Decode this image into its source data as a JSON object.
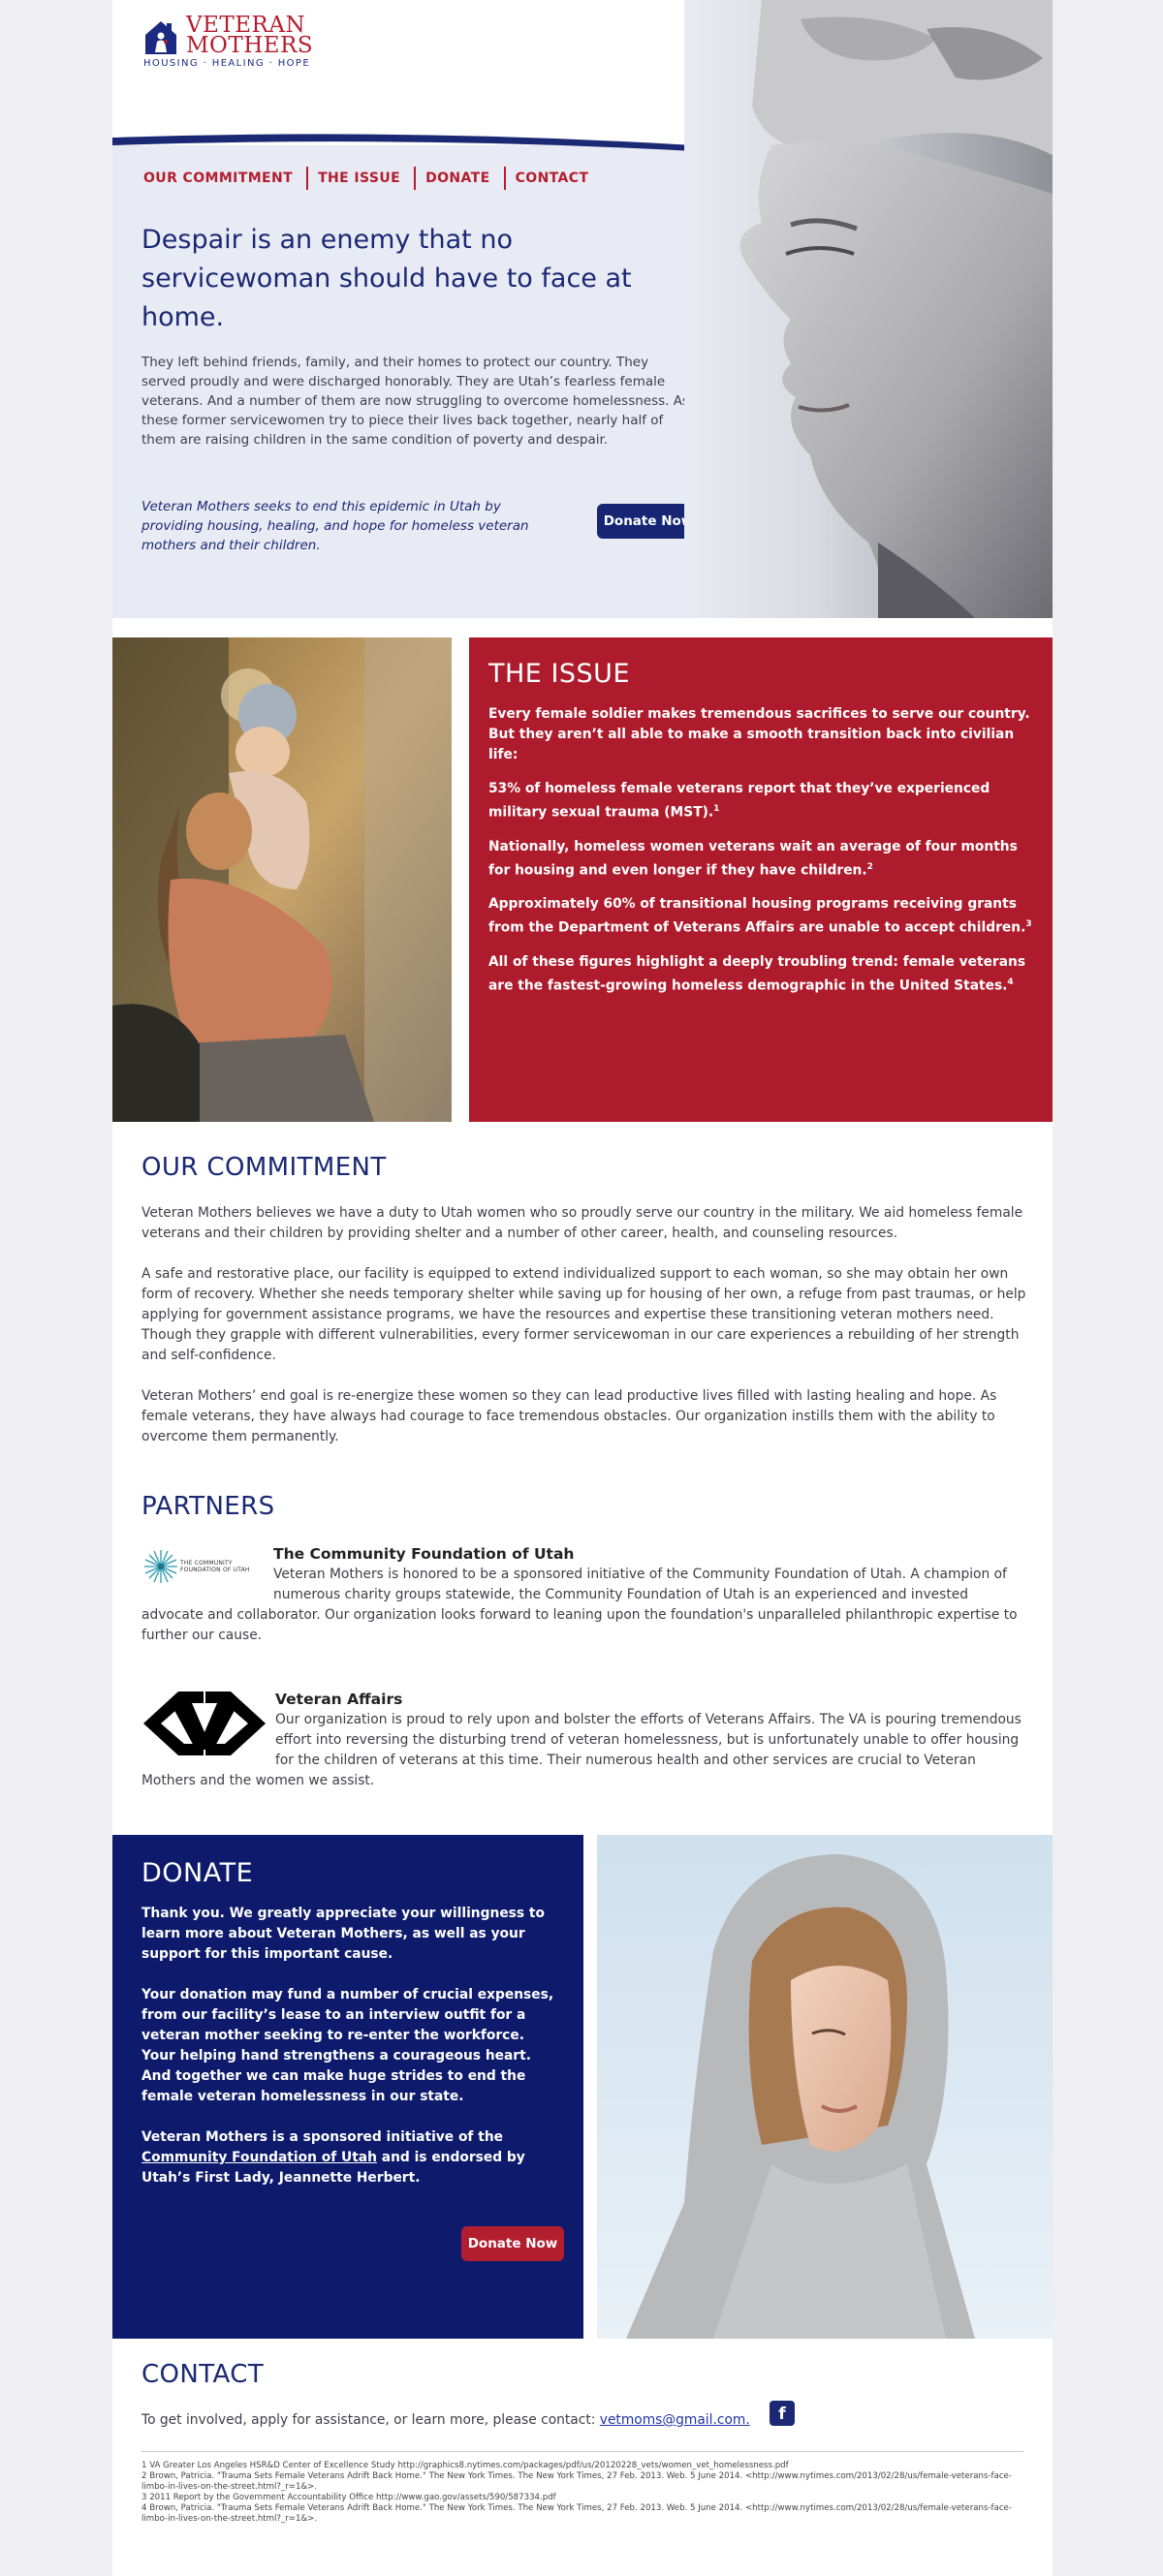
{
  "brand": {
    "name_line1": "VETERAN",
    "name_line2": "MOTHERS",
    "tagline": "HOUSING · HEALING · HOPE",
    "navy": "#162674",
    "red": "#ae1b2c"
  },
  "nav": {
    "items": [
      "OUR COMMITMENT",
      "THE ISSUE",
      "DONATE",
      "CONTACT"
    ]
  },
  "hero": {
    "heading": "Despair is an enemy that no servicewoman should have to face at home.",
    "body": "They left behind friends, family, and their homes to protect our country. They served proudly and were discharged honorably. They are Utah’s fearless female veterans. And a number of them are now struggling to overcome homelessness. As these former servicewomen try to piece their lives back together, nearly half of them are raising children in the same condition of poverty and despair.",
    "mission": "Veteran Mothers seeks to end this epidemic in Utah by providing housing, healing, and hope for homeless veteran mothers and their children.",
    "donate_label": "Donate Now"
  },
  "issue": {
    "title": "THE ISSUE",
    "intro": "Every female soldier makes tremendous sacrifices to serve our country. But they aren’t all able to make a smooth transition back into civilian life:",
    "stat1": "53% of homeless female veterans report that they’ve experienced military sexual trauma (MST).",
    "stat1_ref": "1",
    "stat2": "Nationally, homeless women veterans wait an average of four months for housing and even longer if they have children.",
    "stat2_ref": "2",
    "stat3": "Approximately 60% of transitional housing programs receiving grants from the Department of Veterans Affairs are unable to accept children.",
    "stat3_ref": "3",
    "stat4": "All of these figures highlight a deeply troubling trend: female veterans are the fastest-growing homeless demographic in the United States.",
    "stat4_ref": "4"
  },
  "commitment": {
    "title": "OUR COMMITMENT",
    "p1": "Veteran Mothers believes we have a duty to Utah women who so proudly serve our country in the military. We aid homeless female veterans and their children by providing shelter and a number of other career, health, and counseling resources.",
    "p2": "A safe and restorative place, our facility is equipped to extend individualized support to each woman, so she may obtain her own form of recovery. Whether she needs temporary shelter while saving up for housing of her own, a refuge from past traumas, or help applying for government assistance programs, we have the resources and expertise these transitioning veteran mothers need. Though they grapple with different vulnerabilities, every former servicewoman in our care experiences a rebuilding of her strength and self-confidence.",
    "p3": "Veteran Mothers’ end goal is re-energize these women so they can lead productive lives filled with lasting healing and hope. As female veterans, they have always had courage to face tremendous obstacles. Our organization instills them with the ability to overcome them permanently."
  },
  "partners": {
    "title": "PARTNERS",
    "cfu_logo_text": "THE COMMUNITY FOUNDATION OF UTAH",
    "cfu_name": "The Community Foundation of Utah",
    "cfu_text": "Veteran Mothers is honored to be a sponsored initiative of the Community Foundation of Utah. A champion of numerous charity groups statewide, the Community Foundation of Utah is an experienced and invested advocate and collaborator. Our organization looks forward to leaning upon the foundation's unparalleled philanthropic expertise to further our cause.",
    "va_name": "Veteran Affairs",
    "va_text": "Our organization is proud to rely upon and bolster the efforts of Veterans Affairs. The VA is pouring tremendous effort into reversing the disturbing trend of veteran homelessness, but is unfortunately unable to offer housing for the children of veterans at this time. Their numerous health and other services are crucial to Veteran Mothers and the women we assist."
  },
  "donate": {
    "title": "DONATE",
    "p1": "Thank you. We greatly appreciate your willingness to learn more about Veteran Mothers, as well as your support for this important cause.",
    "p2": "Your donation may fund a number of crucial expenses, from our facility’s lease to an interview outfit for a veteran mother seeking to re-enter the workforce. Your helping hand strengthens a courageous heart. And together we can make huge strides to end the female veteran homelessness in our state.",
    "p3_before": "Veteran Mothers is a sponsored initiative of the ",
    "p3_link": "Community Foundation of Utah",
    "p3_after": " and is endorsed by Utah’s First Lady, Jeannette Herbert.",
    "button": "Donate Now"
  },
  "contact": {
    "title": "CONTACT",
    "text": "To get involved, apply for assistance, or learn more, please contact: ",
    "email": "vetmoms@gmail.com.",
    "fb_glyph": "f"
  },
  "footnotes": [
    "1 VA Greater Los Angeles HSR&D Center of Excellence Study http://graphics8.nytimes.com/packages/pdf/us/20120228_vets/women_vet_homelessness.pdf",
    "2 Brown, Patricia. \"Trauma Sets Female Veterans Adrift Back Home.\" The New York Times. The New York Times, 27 Feb. 2013. Web. 5 June 2014. <http://www.nytimes.com/2013/02/28/us/female-veterans-face-limbo-in-lives-on-the-street.html?_r=1&>.",
    "3 2011 Report by the Government Accountability Office http://www.gao.gov/assets/590/587334.pdf",
    "4 Brown, Patricia. \"Trauma Sets Female Veterans Adrift Back Home.\" The New York Times. The New York Times, 27 Feb. 2013. Web. 5 June 2014. <http://www.nytimes.com/2013/02/28/us/female-veterans-face-limbo-in-lives-on-the-street.html?_r=1&>."
  ]
}
